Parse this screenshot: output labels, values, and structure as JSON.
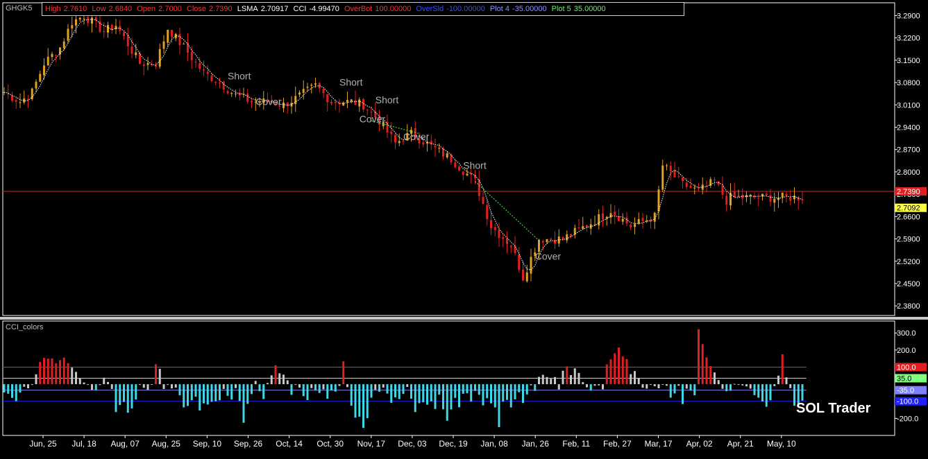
{
  "symbol": "GHGK5",
  "header": {
    "high_label": "High",
    "high": "2.7610",
    "low_label": "Low",
    "low": "2.6840",
    "open_label": "Open",
    "open": "2.7000",
    "close_label": "Close",
    "close": "2.7390",
    "lsma_label": "LSMA",
    "lsma": "2.70917",
    "cci_label": "CCI",
    "cci": "-4.99470",
    "overbot_label": "OverBot",
    "overbot": "100.00000",
    "oversld_label": "OverSld",
    "oversld": "-100.00000",
    "plot4_label": "Plot 4",
    "plot4": "-35.00000",
    "plot5_label": "Plot 5",
    "plot5": "35.00000"
  },
  "colors": {
    "background": "#000000",
    "grid_border": "#ffffff",
    "candle_down": "#e02020",
    "candle_up": "#e0a020",
    "lsma_line": "#ffffff",
    "signal_line": "#40ff40",
    "cci_above": "#e02020",
    "cci_below": "#40d8e8",
    "cci_neutral": "#c8c8c8",
    "overbot_line": "#ff2020",
    "oversld_line": "#2020ff",
    "plot4_line": "#8080ff",
    "plot5_line": "#80ff80",
    "last_price_line": "#e02020",
    "header_red": "#ff3030",
    "header_blue": "#3050ff",
    "header_green": "#50ff50",
    "header_white": "#ffffff",
    "header_lilac": "#9090ff"
  },
  "panel2_title": "CCI_colors",
  "brand": "SOL Trader",
  "chart_data": [
    {
      "type": "candlestick",
      "ylim": [
        2.35,
        3.33
      ],
      "y_ticks": [
        "3.2900",
        "3.2200",
        "3.1500",
        "3.0800",
        "3.0100",
        "2.9400",
        "2.8700",
        "2.8000",
        "2.7300",
        "2.6600",
        "2.5900",
        "2.5200",
        "2.4500",
        "2.3800"
      ],
      "last_close": "2.7390",
      "lsma_value": "2.7092",
      "signals": [
        {
          "label": "Short",
          "x": 56,
          "y": 3.09
        },
        {
          "label": "Cover",
          "x": 63,
          "y": 3.01
        },
        {
          "label": "Short",
          "x": 84,
          "y": 3.07
        },
        {
          "label": "Short",
          "x": 93,
          "y": 3.015
        },
        {
          "label": "Cover",
          "x": 89,
          "y": 2.955
        },
        {
          "label": "Cover",
          "x": 100,
          "y": 2.9
        },
        {
          "label": "Short",
          "x": 115,
          "y": 2.81
        },
        {
          "label": "Cover",
          "x": 133,
          "y": 2.525
        }
      ],
      "signal_lines": [
        {
          "x0": 92,
          "y0": 2.96,
          "x1": 104,
          "y1": 2.92
        },
        {
          "x0": 118,
          "y0": 2.77,
          "x1": 134,
          "y1": 2.585
        }
      ],
      "anchors": [
        [
          0,
          3.05
        ],
        [
          4,
          3.02
        ],
        [
          7,
          3.05
        ],
        [
          10,
          3.14
        ],
        [
          14,
          3.19
        ],
        [
          17,
          3.27
        ],
        [
          20,
          3.29
        ],
        [
          25,
          3.24
        ],
        [
          28,
          3.26
        ],
        [
          30,
          3.22
        ],
        [
          34,
          3.14
        ],
        [
          38,
          3.14
        ],
        [
          41,
          3.25
        ],
        [
          45,
          3.19
        ],
        [
          50,
          3.11
        ],
        [
          54,
          3.08
        ],
        [
          58,
          3.04
        ],
        [
          62,
          3.02
        ],
        [
          66,
          3.02
        ],
        [
          70,
          3.01
        ],
        [
          73,
          3.03
        ],
        [
          78,
          3.07
        ],
        [
          82,
          3.02
        ],
        [
          87,
          3.02
        ],
        [
          90,
          3.01
        ],
        [
          94,
          2.96
        ],
        [
          98,
          2.89
        ],
        [
          102,
          2.92
        ],
        [
          107,
          2.88
        ],
        [
          112,
          2.84
        ],
        [
          118,
          2.77
        ],
        [
          122,
          2.63
        ],
        [
          127,
          2.57
        ],
        [
          130,
          2.47
        ],
        [
          134,
          2.59
        ],
        [
          140,
          2.59
        ],
        [
          147,
          2.64
        ],
        [
          152,
          2.68
        ],
        [
          157,
          2.63
        ],
        [
          163,
          2.66
        ],
        [
          165,
          2.82
        ],
        [
          170,
          2.76
        ],
        [
          174,
          2.74
        ],
        [
          178,
          2.77
        ],
        [
          181,
          2.71
        ],
        [
          182,
          2.72
        ]
      ]
    },
    {
      "type": "bar",
      "name": "CCI_colors",
      "ylim": [
        -300,
        370
      ],
      "y_ticks": [
        "300.0",
        "200.0",
        "100.0",
        "35.0",
        "-35.0",
        "-100.0",
        "-200.0"
      ],
      "levels": {
        "overbot": 100,
        "plot5": 35,
        "plot4": -35,
        "oversld": -100
      },
      "x_labels": [
        "Jun, 25",
        "Jul, 18",
        "Aug, 07",
        "Aug, 25",
        "Sep, 10",
        "Sep, 26",
        "Oct, 14",
        "Oct, 30",
        "Nov, 17",
        "Dec, 03",
        "Dec, 19",
        "Jan, 08",
        "Jan, 26",
        "Feb, 11",
        "Feb, 27",
        "Mar, 17",
        "Apr, 02",
        "Apr, 21",
        "May, 10"
      ],
      "values": [
        -48,
        -56,
        -80,
        -99,
        -49,
        -15,
        -24,
        0,
        58,
        131,
        154,
        150,
        151,
        122,
        141,
        156,
        123,
        97,
        72,
        34,
        10,
        -2,
        -33,
        -35,
        -5,
        38,
        13,
        -28,
        -163,
        -122,
        -104,
        -167,
        -142,
        -90,
        -3,
        -21,
        -33,
        -1,
        117,
        90,
        -28,
        -3,
        -25,
        -20,
        -65,
        -136,
        -127,
        -94,
        -73,
        -154,
        -112,
        -119,
        -103,
        -100,
        -94,
        -28,
        -68,
        -90,
        -23,
        -98,
        -226,
        -115,
        -58,
        19,
        -41,
        -87,
        7,
        52,
        111,
        64,
        56,
        23,
        -62,
        -1,
        -20,
        -70,
        -93,
        -23,
        -36,
        -51,
        -30,
        -85,
        -36,
        -43,
        -10,
        134,
        -17,
        -126,
        -196,
        -190,
        -256,
        -199,
        -79,
        -33,
        -44,
        -20,
        -55,
        -109,
        -77,
        -87,
        -57,
        -16,
        -85,
        -163,
        -111,
        -106,
        -120,
        -100,
        -145,
        -61,
        -147,
        -214,
        -148,
        -80,
        -135,
        -56,
        -53,
        -102,
        -39,
        -62,
        -124,
        -82,
        -112,
        -136,
        -251,
        -102,
        -92,
        -136,
        -89,
        -47,
        -110,
        -60,
        -6,
        -39,
        43,
        55,
        42,
        32,
        42,
        -31,
        79,
        104,
        53,
        93,
        66,
        12,
        -18,
        -37,
        -9,
        -7,
        -30,
        116,
        146,
        181,
        215,
        162,
        147,
        59,
        77,
        33,
        -21,
        -26,
        0,
        -12,
        -24,
        -3,
        -9,
        -79,
        -54,
        -9,
        -116,
        -26,
        -37,
        -65,
        322,
        235,
        157,
        106,
        69,
        24,
        -27,
        -41,
        -38,
        2,
        -3,
        -7,
        -13,
        -26,
        -64,
        -79,
        -101,
        -132,
        -94,
        -11,
        50,
        175,
        40,
        -23,
        -126,
        -124,
        -96
      ]
    }
  ]
}
